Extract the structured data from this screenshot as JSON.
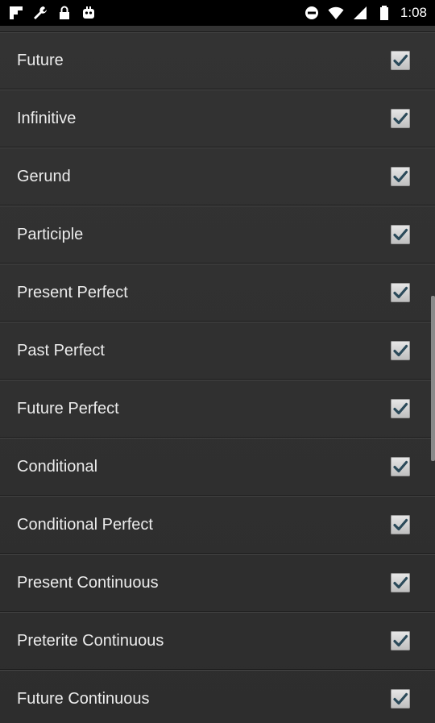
{
  "status_bar": {
    "time": "1:08",
    "left_icons": [
      "flipboard-icon",
      "wrench-icon",
      "lock-icon",
      "gamepad-icon"
    ],
    "right_icons": [
      "do-not-disturb-icon",
      "wifi-icon",
      "cellular-signal-icon",
      "battery-icon"
    ]
  },
  "list": {
    "items": [
      {
        "label": "Future",
        "checked": true
      },
      {
        "label": "Infinitive",
        "checked": true
      },
      {
        "label": "Gerund",
        "checked": true
      },
      {
        "label": "Participle",
        "checked": true
      },
      {
        "label": "Present Perfect",
        "checked": true
      },
      {
        "label": "Past Perfect",
        "checked": true
      },
      {
        "label": "Future Perfect",
        "checked": true
      },
      {
        "label": "Conditional",
        "checked": true
      },
      {
        "label": "Conditional Perfect",
        "checked": true
      },
      {
        "label": "Present Continuous",
        "checked": true
      },
      {
        "label": "Preterite Continuous",
        "checked": true
      },
      {
        "label": "Future Continuous",
        "checked": true
      }
    ]
  },
  "colors": {
    "background": "#2d2d2d",
    "text": "#ececec",
    "checkmark": "#2b4a5a"
  }
}
